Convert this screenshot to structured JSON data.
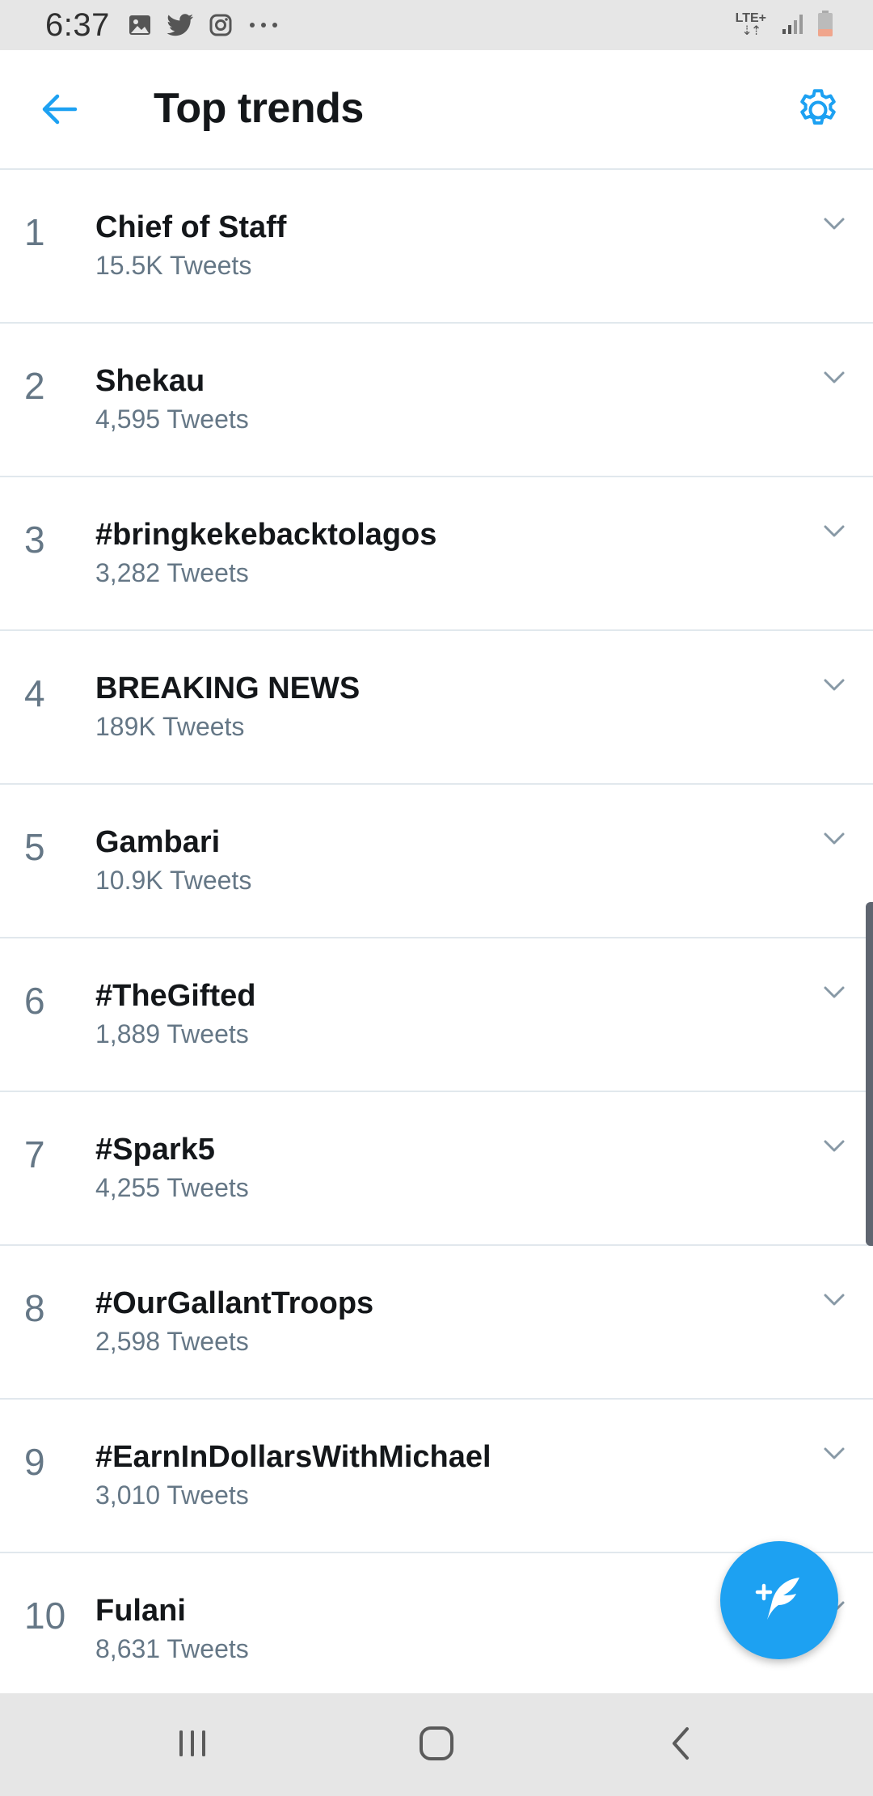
{
  "status_bar": {
    "time": "6:37",
    "network": "LTE+",
    "icons": [
      "gallery-icon",
      "twitter-bird-icon",
      "instagram-icon",
      "more-dots-icon",
      "signal-icon",
      "battery-low-icon"
    ]
  },
  "header": {
    "title": "Top trends",
    "back_icon": "arrow-left-icon",
    "settings_icon": "gear-icon"
  },
  "trends": [
    {
      "rank": "1",
      "name": "Chief of Staff",
      "count": "15.5K Tweets"
    },
    {
      "rank": "2",
      "name": "Shekau",
      "count": "4,595 Tweets"
    },
    {
      "rank": "3",
      "name": "#bringkekebacktolagos",
      "count": "3,282 Tweets"
    },
    {
      "rank": "4",
      "name": "BREAKING NEWS",
      "count": "189K Tweets"
    },
    {
      "rank": "5",
      "name": "Gambari",
      "count": "10.9K Tweets"
    },
    {
      "rank": "6",
      "name": "#TheGifted",
      "count": "1,889 Tweets"
    },
    {
      "rank": "7",
      "name": "#Spark5",
      "count": "4,255 Tweets"
    },
    {
      "rank": "8",
      "name": "#OurGallantTroops",
      "count": "2,598 Tweets"
    },
    {
      "rank": "9",
      "name": "#EarnInDollarsWithMichael",
      "count": "3,010 Tweets"
    },
    {
      "rank": "10",
      "name": "Fulani",
      "count": "8,631 Tweets"
    }
  ],
  "fab": {
    "icon": "compose-tweet-icon"
  },
  "colors": {
    "accent": "#1da1f2",
    "text_primary": "#14171a",
    "text_secondary": "#657786",
    "divider": "#e1e8ed"
  }
}
